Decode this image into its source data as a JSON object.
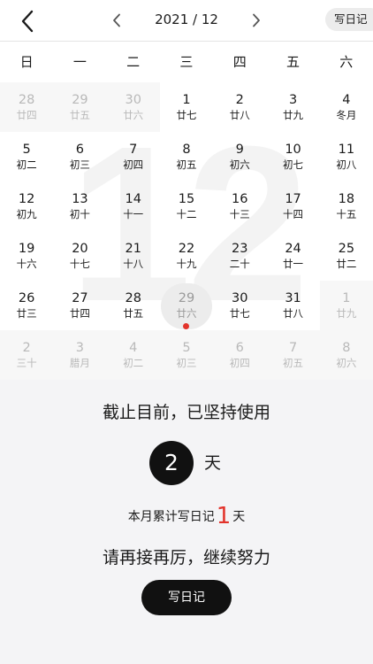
{
  "header": {
    "month_label": "2021 / 12",
    "write_button_label": "写日记"
  },
  "icons": {
    "back": "chevron-left-icon",
    "prev_month": "chevron-left-icon",
    "next_month": "chevron-right-icon"
  },
  "weekdays": [
    "日",
    "一",
    "二",
    "三",
    "四",
    "五",
    "六"
  ],
  "background_month_number": "12",
  "calendar": {
    "weeks": [
      [
        {
          "day": "28",
          "lunar": "廿四",
          "in_month": false
        },
        {
          "day": "29",
          "lunar": "廿五",
          "in_month": false
        },
        {
          "day": "30",
          "lunar": "廿六",
          "in_month": false
        },
        {
          "day": "1",
          "lunar": "廿七",
          "in_month": true
        },
        {
          "day": "2",
          "lunar": "廿八",
          "in_month": true
        },
        {
          "day": "3",
          "lunar": "廿九",
          "in_month": true
        },
        {
          "day": "4",
          "lunar": "冬月",
          "in_month": true
        }
      ],
      [
        {
          "day": "5",
          "lunar": "初二",
          "in_month": true
        },
        {
          "day": "6",
          "lunar": "初三",
          "in_month": true
        },
        {
          "day": "7",
          "lunar": "初四",
          "in_month": true
        },
        {
          "day": "8",
          "lunar": "初五",
          "in_month": true
        },
        {
          "day": "9",
          "lunar": "初六",
          "in_month": true
        },
        {
          "day": "10",
          "lunar": "初七",
          "in_month": true
        },
        {
          "day": "11",
          "lunar": "初八",
          "in_month": true
        }
      ],
      [
        {
          "day": "12",
          "lunar": "初九",
          "in_month": true
        },
        {
          "day": "13",
          "lunar": "初十",
          "in_month": true
        },
        {
          "day": "14",
          "lunar": "十一",
          "in_month": true
        },
        {
          "day": "15",
          "lunar": "十二",
          "in_month": true
        },
        {
          "day": "16",
          "lunar": "十三",
          "in_month": true
        },
        {
          "day": "17",
          "lunar": "十四",
          "in_month": true
        },
        {
          "day": "18",
          "lunar": "十五",
          "in_month": true
        }
      ],
      [
        {
          "day": "19",
          "lunar": "十六",
          "in_month": true
        },
        {
          "day": "20",
          "lunar": "十七",
          "in_month": true
        },
        {
          "day": "21",
          "lunar": "十八",
          "in_month": true
        },
        {
          "day": "22",
          "lunar": "十九",
          "in_month": true
        },
        {
          "day": "23",
          "lunar": "二十",
          "in_month": true
        },
        {
          "day": "24",
          "lunar": "廿一",
          "in_month": true
        },
        {
          "day": "25",
          "lunar": "廿二",
          "in_month": true
        }
      ],
      [
        {
          "day": "26",
          "lunar": "廿三",
          "in_month": true
        },
        {
          "day": "27",
          "lunar": "廿四",
          "in_month": true
        },
        {
          "day": "28",
          "lunar": "廿五",
          "in_month": true
        },
        {
          "day": "29",
          "lunar": "廿六",
          "in_month": true,
          "today": true,
          "has_entry": true
        },
        {
          "day": "30",
          "lunar": "廿七",
          "in_month": true
        },
        {
          "day": "31",
          "lunar": "廿八",
          "in_month": true
        },
        {
          "day": "1",
          "lunar": "廿九",
          "in_month": false
        }
      ],
      [
        {
          "day": "2",
          "lunar": "三十",
          "in_month": false
        },
        {
          "day": "3",
          "lunar": "腊月",
          "in_month": false
        },
        {
          "day": "4",
          "lunar": "初二",
          "in_month": false
        },
        {
          "day": "5",
          "lunar": "初三",
          "in_month": false
        },
        {
          "day": "6",
          "lunar": "初四",
          "in_month": false
        },
        {
          "day": "7",
          "lunar": "初五",
          "in_month": false
        },
        {
          "day": "8",
          "lunar": "初六",
          "in_month": false
        }
      ]
    ]
  },
  "colors": {
    "accent_red": "#e2332b",
    "dark": "#111111",
    "faded_text": "#b9b9b9"
  },
  "stats": {
    "headline": "截止目前，已坚持使用",
    "days_value": "2",
    "days_unit": "天",
    "month_prefix": "本月累计写日记",
    "month_value": "1",
    "month_unit": "天",
    "encourage": "请再接再厉，继续努力",
    "write_button_label": "写日记"
  }
}
